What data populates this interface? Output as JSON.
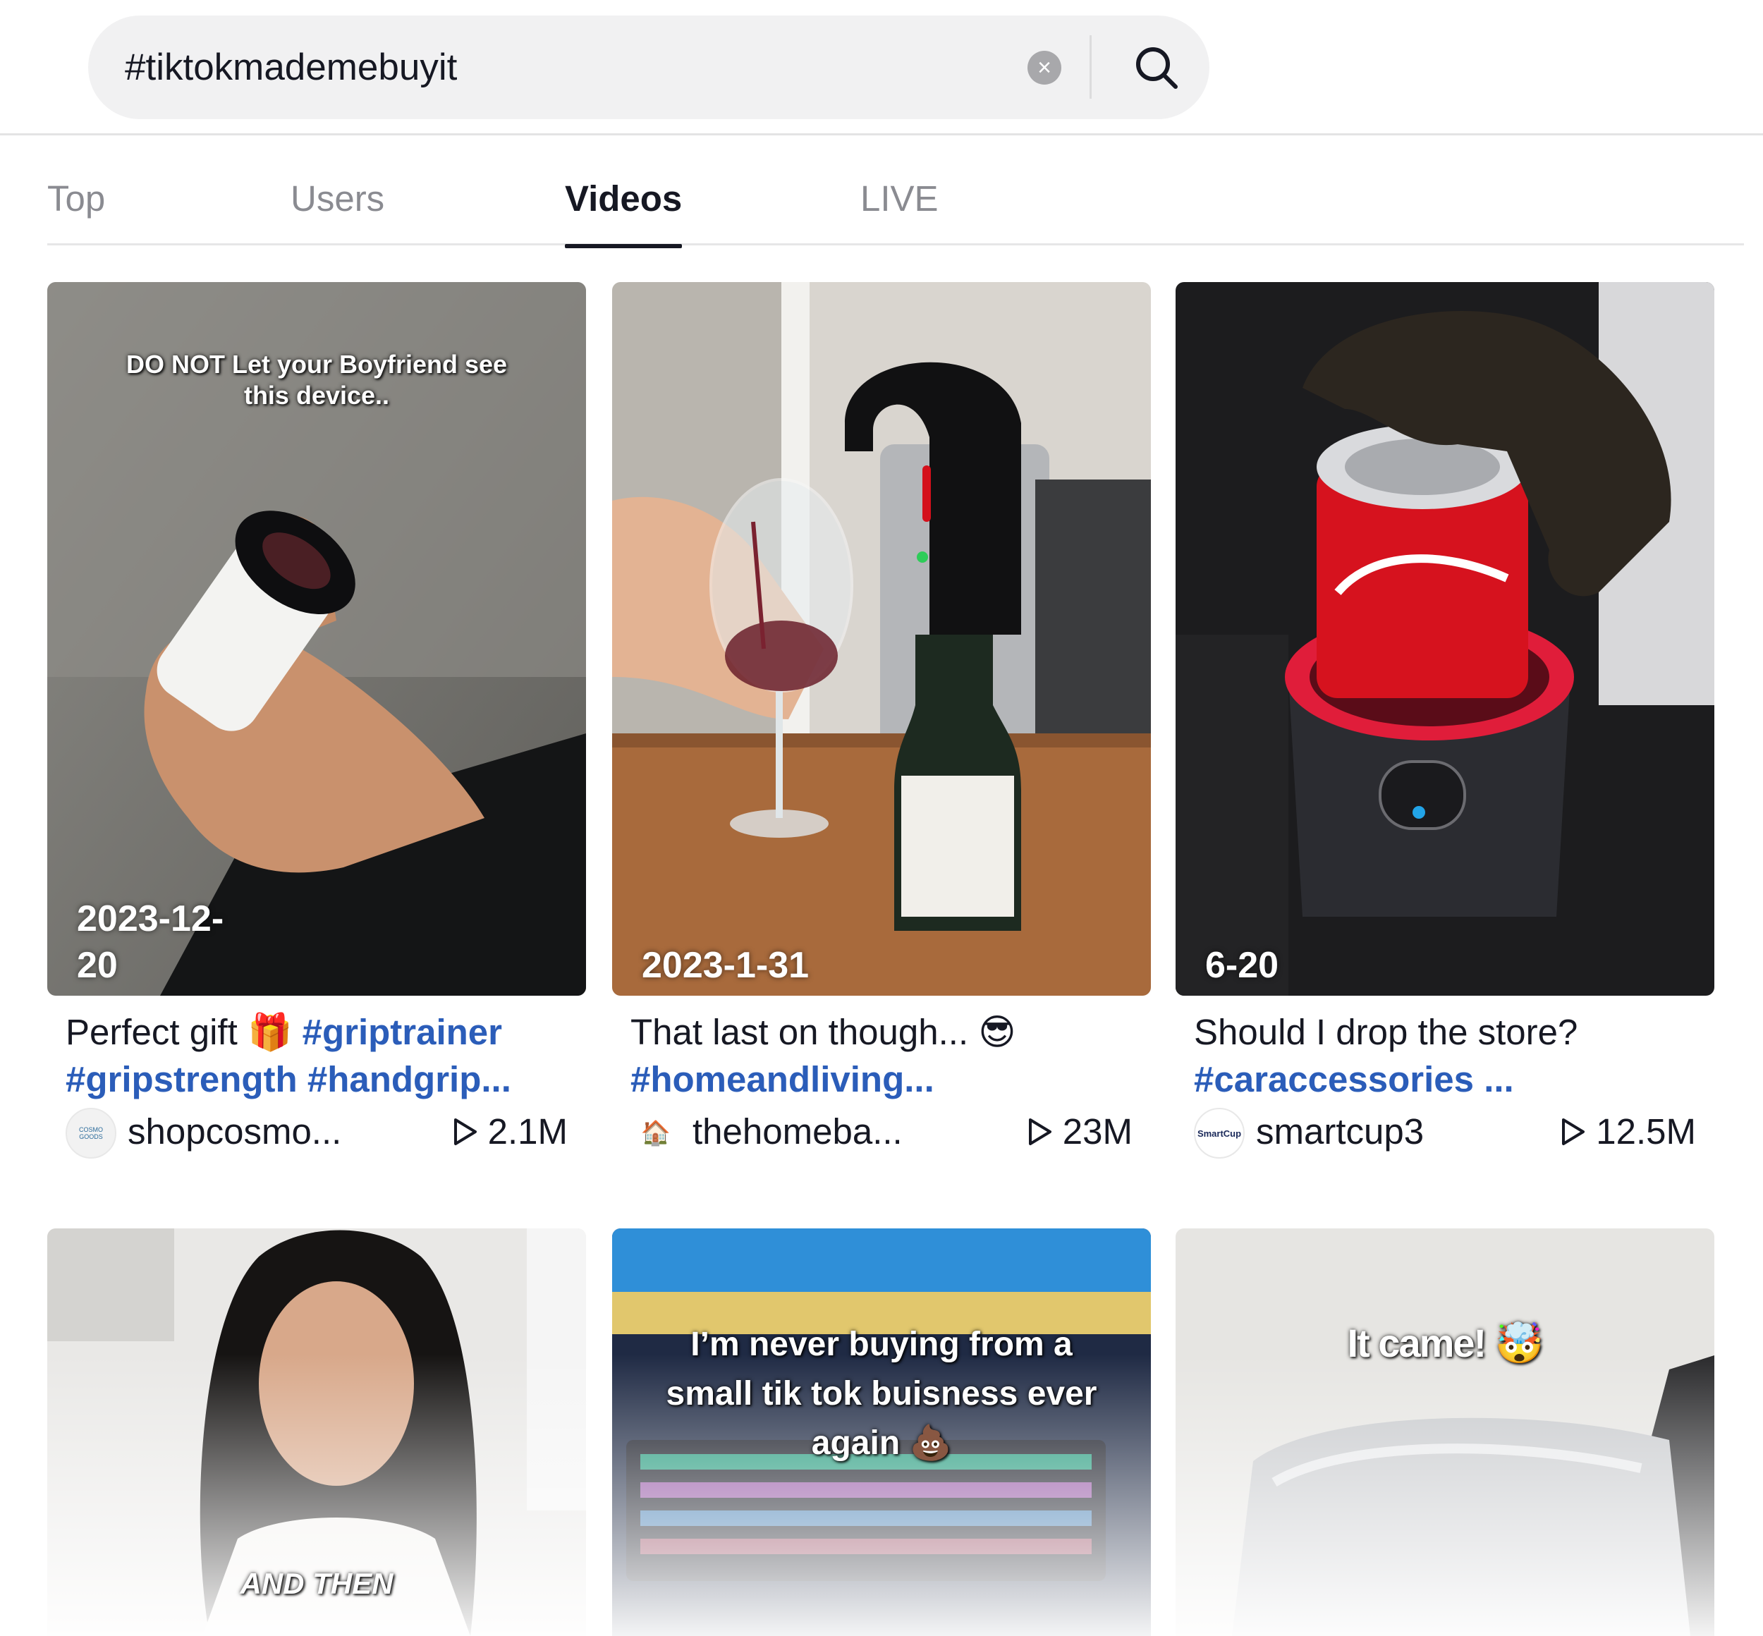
{
  "search": {
    "query": "#tiktokmademebuyit"
  },
  "tabs": [
    {
      "label": "Top",
      "active": false
    },
    {
      "label": "Users",
      "active": false
    },
    {
      "label": "Videos",
      "active": true
    },
    {
      "label": "LIVE",
      "active": false
    }
  ],
  "videos": [
    {
      "overlay": "DO NOT Let your Boyfriend see this device..",
      "date": "2023-12-20",
      "caption_text": "Perfect gift 🎁 ",
      "caption_tags": "#griptrainer #gripstrength #handgrip...",
      "author": "shopcosmo...",
      "avatar_text": "COSMO GOODS",
      "views": "2.1M"
    },
    {
      "overlay": "",
      "date": "2023-1-31",
      "caption_text": "That last on though... 😎",
      "caption_tags": "#homeandliving...",
      "author": "thehomeba...",
      "avatar_text": "🏠",
      "views": "23M"
    },
    {
      "overlay": "",
      "date": "6-20",
      "caption_text": "Should I drop the store?",
      "caption_tags": "#caraccessories ...",
      "author": "smartcup3",
      "avatar_text": "SmartCup",
      "views": "12.5M"
    },
    {
      "overlay": "AND THEN",
      "date": "",
      "caption_text": "",
      "caption_tags": "",
      "author": "",
      "avatar_text": "",
      "views": ""
    },
    {
      "overlay": "I’m never buying from a small tik tok buisness ever again 💩",
      "date": "",
      "caption_text": "",
      "caption_tags": "",
      "author": "",
      "avatar_text": "",
      "views": ""
    },
    {
      "overlay": "It came! 🤯",
      "date": "",
      "caption_text": "",
      "caption_tags": "",
      "author": "",
      "avatar_text": "",
      "views": ""
    }
  ],
  "icons": {
    "clear": "close-icon",
    "search": "search-icon",
    "play": "play-icon"
  },
  "colors": {
    "hashtag": "#2b5db9",
    "active_tab": "#161823",
    "inactive_tab": "#8a8b91",
    "search_bg": "#f1f1f2"
  }
}
